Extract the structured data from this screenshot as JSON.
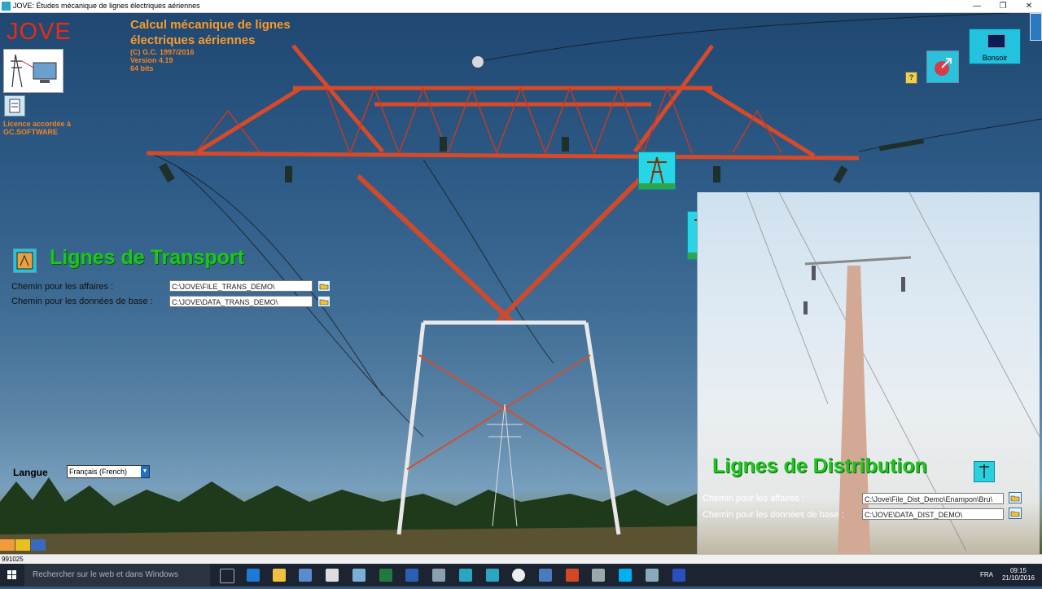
{
  "window": {
    "title": "JOVE: Études mécanique de lignes électriques aériennes",
    "minimize_glyph": "—",
    "restore_glyph": "❐",
    "close_glyph": "✕"
  },
  "header": {
    "logo_text": "JOVE",
    "app_name_line1": "Calcul mécanique de lignes",
    "app_name_line2": "électriques aériennes",
    "copyright": "(C)  G.C. 1997/2016",
    "version": "Version 4.19",
    "bits": "64 bits",
    "licence_line1": "Licence accordée à",
    "licence_line2": "GC.SOFTWARE"
  },
  "transport": {
    "title": "Lignes de Transport",
    "affaires_label": "Chemin pour les affaires :",
    "affaires_value": "C:\\JOVE\\FILE_TRANS_DEMO\\",
    "base_label": "Chemin pour les données de base :",
    "base_value": "C:\\JOVE\\DATA_TRANS_DEMO\\"
  },
  "distribution": {
    "title": "Lignes de Distribution",
    "affaires_label": "Chemin pour les affaires :",
    "affaires_value": "C:\\Jove\\File_Dist_Demo\\Enampon\\Bru\\",
    "base_label": "Chemin pour les données de base :",
    "base_value": "C:\\JOVE\\DATA_DIST_DEMO\\"
  },
  "language": {
    "label": "Langue",
    "selected": "Français (French)"
  },
  "top_right": {
    "bonsoir_label": "Bonsoir",
    "help_label": "?"
  },
  "status": {
    "code": "991025"
  },
  "taskbar": {
    "search_placeholder": "Rechercher sur le web et dans Windows",
    "lang": "FRA",
    "time": "09:15",
    "date": "21/10/2016"
  },
  "colors": {
    "logo_red": "#ee2a12",
    "title_orange": "#f89a2c",
    "section_green": "#1ec51e",
    "tile_cyan": "#26d6e6"
  }
}
